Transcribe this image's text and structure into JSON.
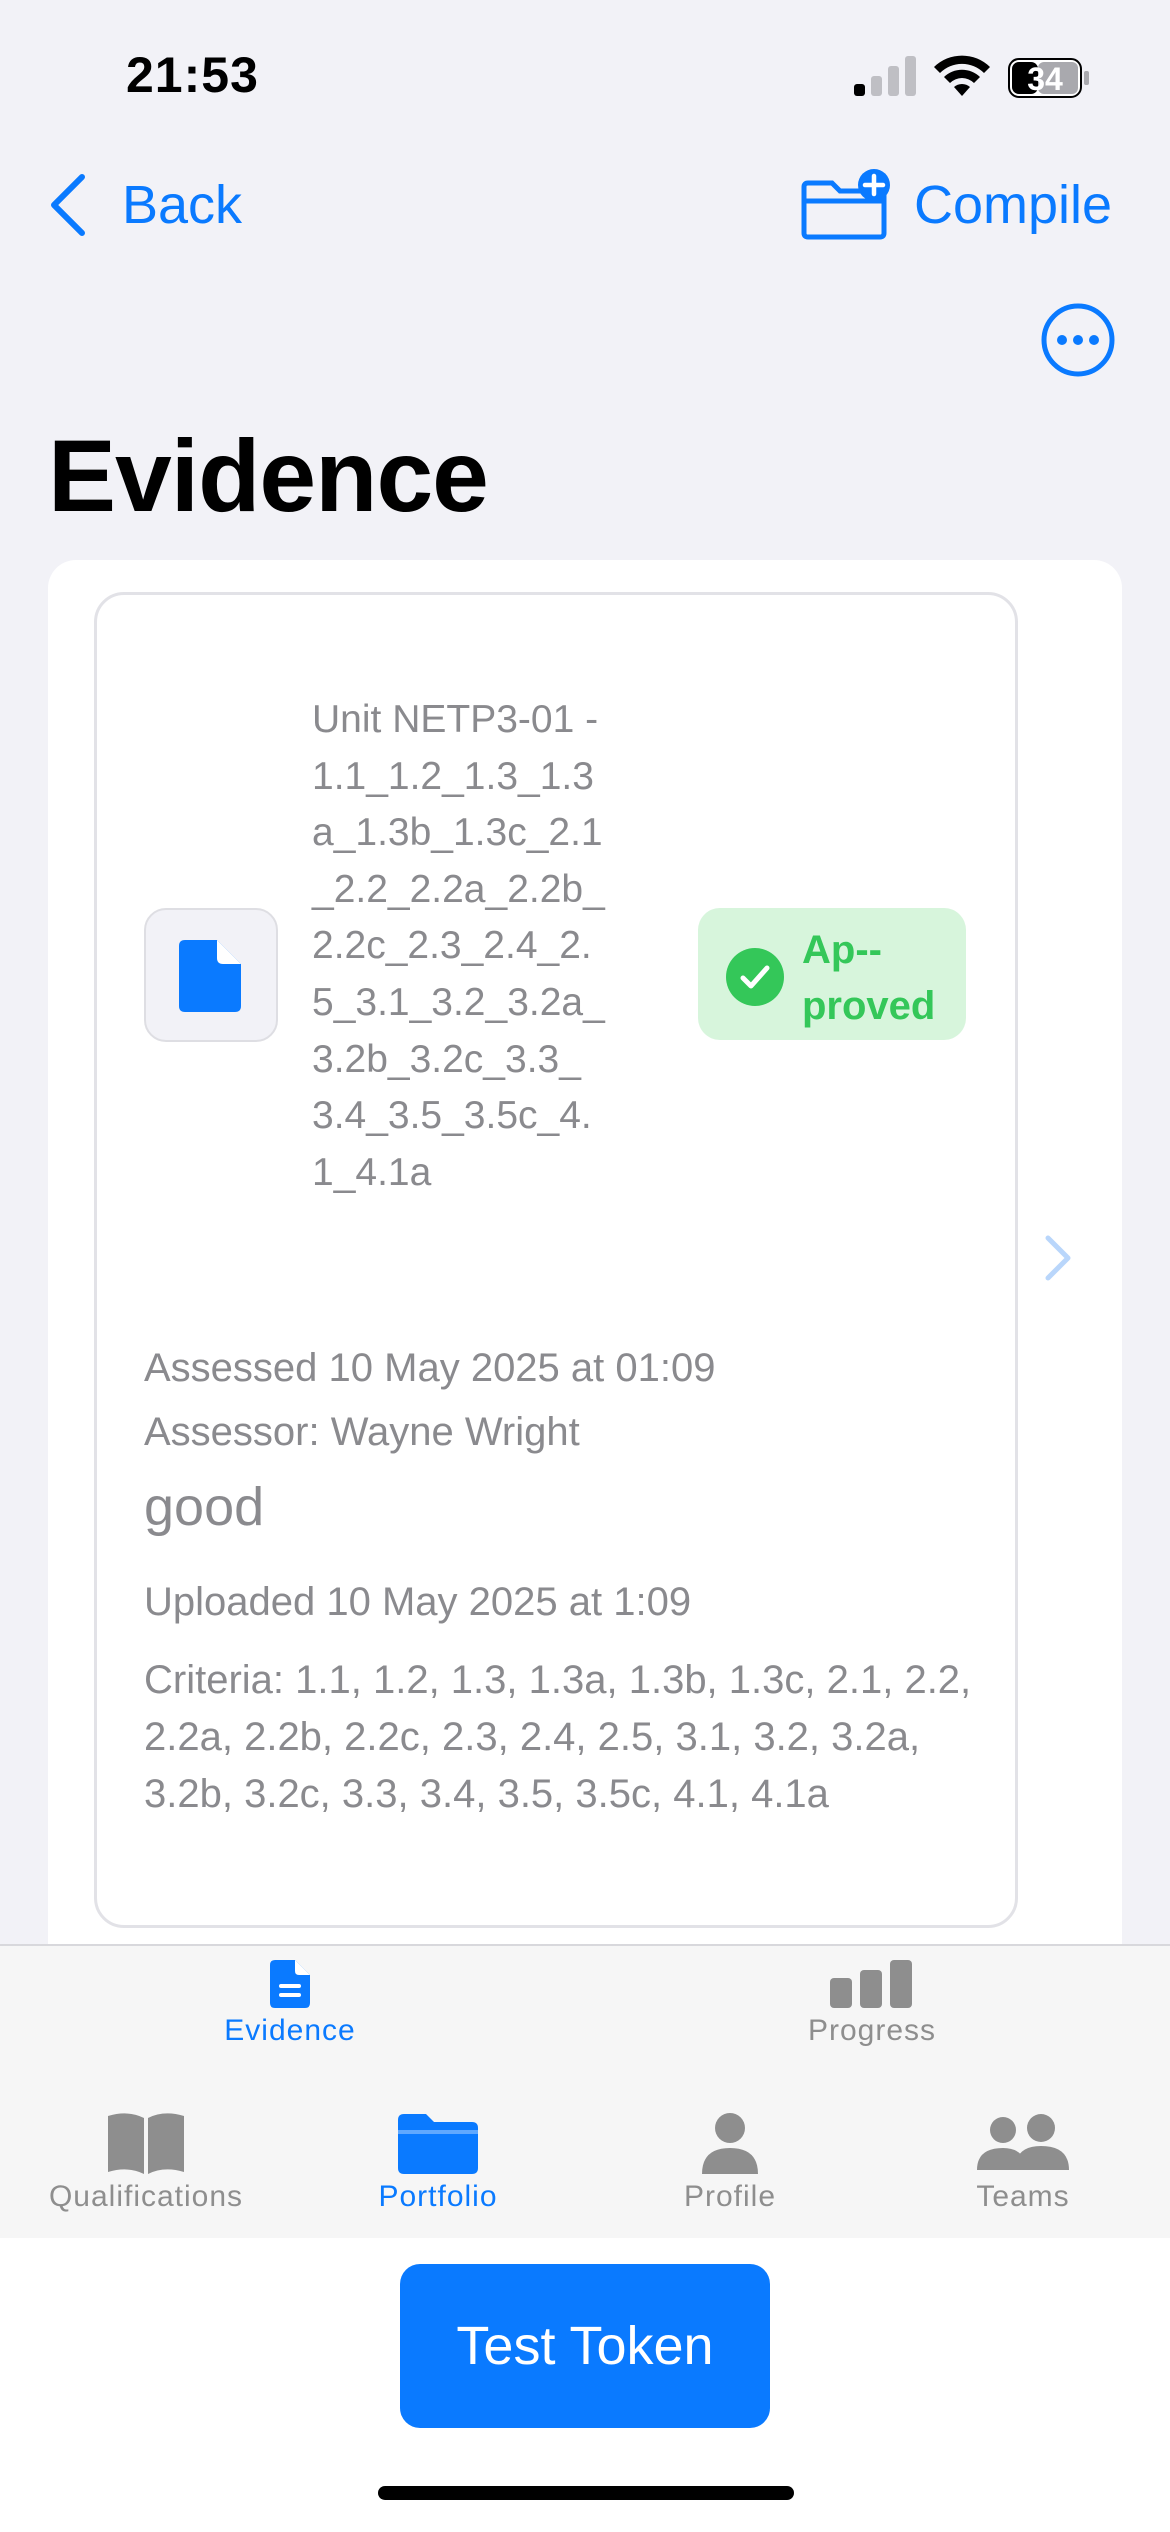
{
  "status_bar": {
    "time": "21:53",
    "battery": "34"
  },
  "nav": {
    "back_label": "Back",
    "compile_label": "Compile"
  },
  "page_title": "Evidence",
  "evidence_card": {
    "unit_name": "Unit NETP3-01 - 1.1_1.2_1.3_1.3a_1.3b_1.3c_2.1_2.2_2.2a_2.2b_2.2c_2.3_2.4_2.5_3.1_3.2_3.2a_3.2b_3.2c_3.3_3.4_3.5_3.5c_4.1_4.1a",
    "status": "Ap-­proved",
    "assessed": "Assessed 10 May 2025 at 01:09",
    "assessor": "Assessor: Wayne Wright",
    "comment": "good",
    "uploaded": "Uploaded 10 May 2025 at 1:09",
    "criteria": "Criteria: 1.1, 1.2, 1.3, 1.3a, 1.3b, 1.3c, 2.1, 2.2, 2.2a, 2.2b, 2.2c, 2.3, 2.4, 2.5, 3.1, 3.2, 3.2a, 3.2b, 3.2c, 3.3, 3.4, 3.5, 3.5c, 4.1, 4.1a"
  },
  "sub_tabs": [
    {
      "label": "Evidence",
      "icon": "document-icon",
      "selected": true
    },
    {
      "label": "Progress",
      "icon": "bar-chart-icon",
      "selected": false
    }
  ],
  "main_tabs": [
    {
      "label": "Qualifications",
      "icon": "book-icon",
      "selected": false
    },
    {
      "label": "Portfolio",
      "icon": "folder-icon",
      "selected": true
    },
    {
      "label": "Profile",
      "icon": "person-icon",
      "selected": false
    },
    {
      "label": "Teams",
      "icon": "people-icon",
      "selected": false
    }
  ],
  "test_button_label": "Test Token",
  "colors": {
    "accent": "#0a7aff",
    "approved": "#34c759",
    "approved_bg": "#d7f5dc",
    "inactive": "#8e8e8e"
  }
}
